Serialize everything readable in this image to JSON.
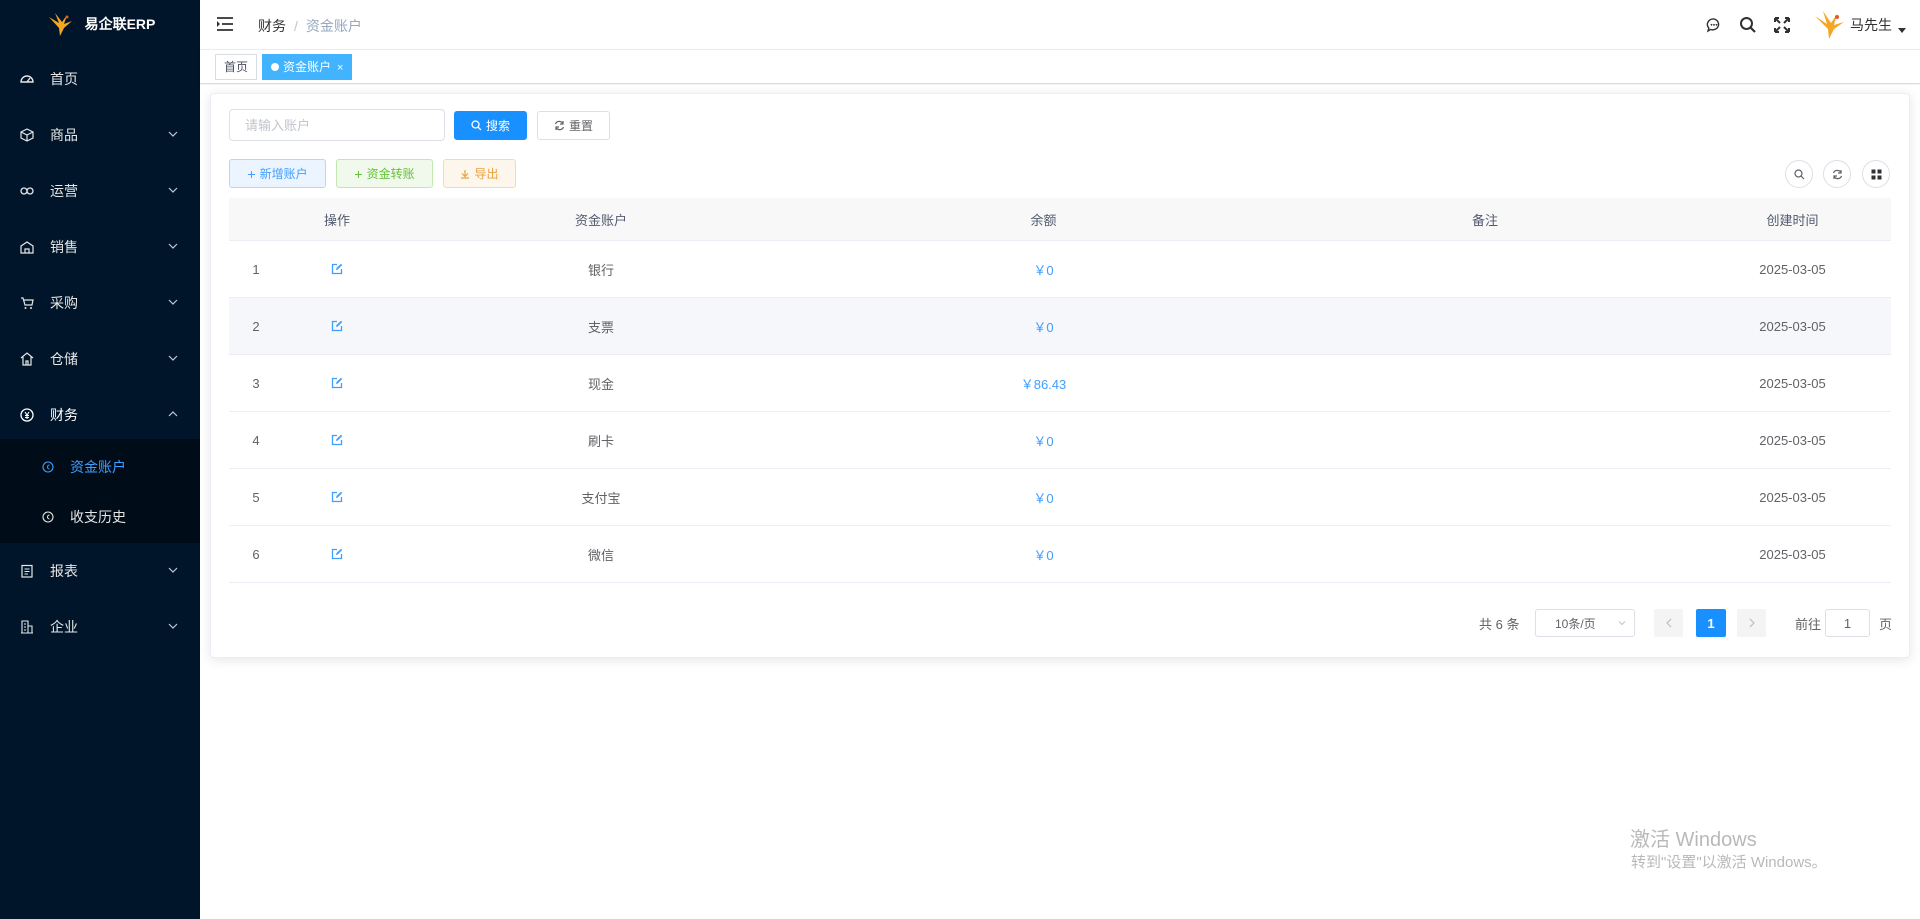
{
  "app": {
    "title": "易企联ERP"
  },
  "sidebar": {
    "items": [
      {
        "label": "首页",
        "icon": "dashboard-icon"
      },
      {
        "label": "商品",
        "icon": "box-icon"
      },
      {
        "label": "运营",
        "icon": "operation-icon"
      },
      {
        "label": "销售",
        "icon": "sales-icon"
      },
      {
        "label": "采购",
        "icon": "cart-icon"
      },
      {
        "label": "仓储",
        "icon": "warehouse-icon"
      },
      {
        "label": "财务",
        "icon": "finance-icon"
      },
      {
        "label": "报表",
        "icon": "report-icon"
      },
      {
        "label": "企业",
        "icon": "company-icon"
      }
    ],
    "finance_sub": [
      {
        "label": "资金账户",
        "active": true
      },
      {
        "label": "收支历史",
        "active": false
      }
    ]
  },
  "header": {
    "breadcrumb": [
      "财务",
      "资金账户"
    ],
    "username": "马先生"
  },
  "tags": [
    {
      "label": "首页",
      "active": false
    },
    {
      "label": "资金账户",
      "active": true
    }
  ],
  "search": {
    "placeholder": "请输入账户",
    "search_label": "搜索",
    "reset_label": "重置"
  },
  "toolbar": {
    "add_label": "新增账户",
    "transfer_label": "资金转账",
    "export_label": "导出"
  },
  "table": {
    "headers": {
      "index": "",
      "action": "操作",
      "account": "资金账户",
      "balance": "余额",
      "note": "备注",
      "created": "创建时间"
    },
    "rows": [
      {
        "index": "1",
        "account": "银行",
        "balance": "￥0",
        "note": "",
        "created": "2025-03-05"
      },
      {
        "index": "2",
        "account": "支票",
        "balance": "￥0",
        "note": "",
        "created": "2025-03-05"
      },
      {
        "index": "3",
        "account": "现金",
        "balance": "￥86.43",
        "note": "",
        "created": "2025-03-05"
      },
      {
        "index": "4",
        "account": "刷卡",
        "balance": "￥0",
        "note": "",
        "created": "2025-03-05"
      },
      {
        "index": "5",
        "account": "支付宝",
        "balance": "￥0",
        "note": "",
        "created": "2025-03-05"
      },
      {
        "index": "6",
        "account": "微信",
        "balance": "￥0",
        "note": "",
        "created": "2025-03-05"
      }
    ]
  },
  "pagination": {
    "total_text": "共 6 条",
    "page_size": "10条/页",
    "current_page": "1",
    "goto_prefix": "前往",
    "goto_value": "1",
    "goto_suffix": "页"
  },
  "watermark": {
    "line1": "激活 Windows",
    "line2": "转到\"设置\"以激活 Windows。"
  },
  "colors": {
    "sidebar_bg": "#001529",
    "primary": "#1890ff",
    "active_menu": "#409eff"
  }
}
